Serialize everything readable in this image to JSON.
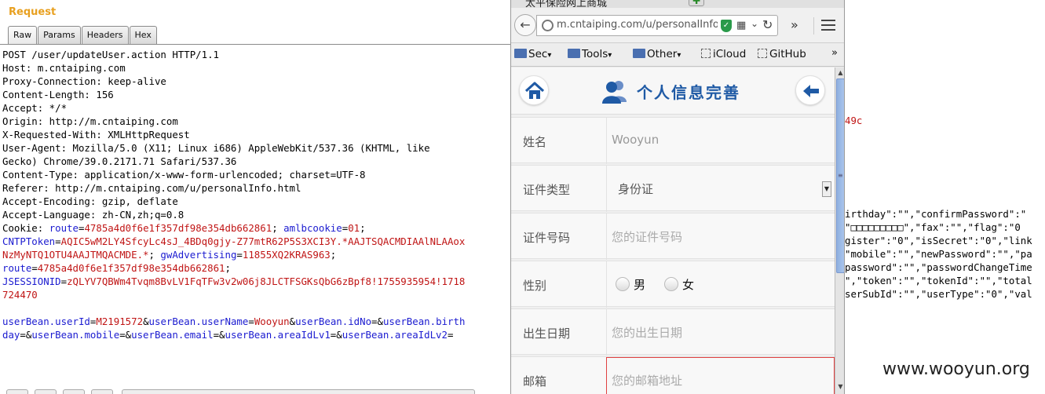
{
  "request": {
    "title": "Request",
    "tabs": [
      "Raw",
      "Params",
      "Headers",
      "Hex"
    ],
    "lines": [
      [
        {
          "t": "POST /user/updateUser.action HTTP/1.1"
        }
      ],
      [
        {
          "t": "Host: m.cntaiping.com"
        }
      ],
      [
        {
          "t": "Proxy-Connection: keep-alive"
        }
      ],
      [
        {
          "t": "Content-Length: 156"
        }
      ],
      [
        {
          "t": "Accept: */*"
        }
      ],
      [
        {
          "t": "Origin: http://m.cntaiping.com"
        }
      ],
      [
        {
          "t": "X-Requested-With: XMLHttpRequest"
        }
      ],
      [
        {
          "t": "User-Agent: Mozilla/5.0 (X11; Linux i686) AppleWebKit/537.36 (KHTML, like"
        }
      ],
      [
        {
          "t": "Gecko) Chrome/39.0.2171.71 Safari/537.36"
        }
      ],
      [
        {
          "t": "Content-Type: application/x-www-form-urlencoded; charset=UTF-8"
        }
      ],
      [
        {
          "t": "Referer: http://m.cntaiping.com/u/personalInfo.html"
        }
      ],
      [
        {
          "t": "Accept-Encoding: gzip, deflate"
        }
      ],
      [
        {
          "t": "Accept-Language: zh-CN,zh;q=0.8"
        }
      ],
      [
        {
          "t": "Cookie: "
        },
        {
          "t": "route",
          "c": "k"
        },
        {
          "t": "="
        },
        {
          "t": "4785a4d0f6e1f357df98e354db662861",
          "c": "v"
        },
        {
          "t": "; "
        },
        {
          "t": "amlbcookie",
          "c": "k"
        },
        {
          "t": "="
        },
        {
          "t": "01",
          "c": "v"
        },
        {
          "t": ";"
        }
      ],
      [
        {
          "t": "CNTPToken",
          "c": "k"
        },
        {
          "t": "="
        },
        {
          "t": "AQIC5wM2LY4SfcyLc4sJ_4BDq0gjy-Z77mtR62P5S3XCI3Y.*AAJTSQACMDIAAlNLAAox",
          "c": "v"
        }
      ],
      [
        {
          "t": "NzMyNTQ1OTU4AAJTMQACMDE.*",
          "c": "v"
        },
        {
          "t": "; "
        },
        {
          "t": "gwAdvertising",
          "c": "k"
        },
        {
          "t": "="
        },
        {
          "t": "11855XQ2KRAS963",
          "c": "v"
        },
        {
          "t": ";"
        }
      ],
      [
        {
          "t": "route",
          "c": "k"
        },
        {
          "t": "="
        },
        {
          "t": "4785a4d0f6e1f357df98e354db662861",
          "c": "v"
        },
        {
          "t": ";"
        }
      ],
      [
        {
          "t": "JSESSIONID",
          "c": "k"
        },
        {
          "t": "="
        },
        {
          "t": "zQLYV7QBWm4Tvqm8BvLV1FqTFw3v2w06j8JLCTFSGKsQbG6zBpf8!1755935954!1718",
          "c": "v"
        }
      ],
      [
        {
          "t": "724470",
          "c": "v"
        }
      ],
      [
        {
          "t": ""
        }
      ],
      [
        {
          "t": "userBean.userId",
          "c": "k"
        },
        {
          "t": "="
        },
        {
          "t": "M2191572",
          "c": "v"
        },
        {
          "t": "&"
        },
        {
          "t": "userBean.userName",
          "c": "k"
        },
        {
          "t": "="
        },
        {
          "t": "Wooyun",
          "c": "v"
        },
        {
          "t": "&"
        },
        {
          "t": "userBean.idNo",
          "c": "k"
        },
        {
          "t": "=&"
        },
        {
          "t": "userBean.birth",
          "c": "k"
        }
      ],
      [
        {
          "t": "day",
          "c": "k"
        },
        {
          "t": "=&"
        },
        {
          "t": "userBean.mobile",
          "c": "k"
        },
        {
          "t": "=&"
        },
        {
          "t": "userBean.email",
          "c": "k"
        },
        {
          "t": "=&"
        },
        {
          "t": "userBean.areaIdLv1",
          "c": "k"
        },
        {
          "t": "=&"
        },
        {
          "t": "userBean.areaIdLv2",
          "c": "k"
        },
        {
          "t": "="
        }
      ]
    ]
  },
  "response_fragment": {
    "code": "49c",
    "lines": [
      "irthday\":\"\",\"confirmPassword\":\"",
      "\"□□□□□□□□□\",\"fax\":\"\",\"flag\":\"0",
      "gister\":\"0\",\"isSecret\":\"0\",\"link",
      "\"mobile\":\"\",\"newPassword\":\"\",\"pa",
      "password\":\"\",\"passwordChangeTime",
      "\",\"token\":\"\",\"tokenId\":\"\",\"total",
      "serSubId\":\"\",\"userType\":\"0\",\"val"
    ],
    "watermark": "www.wooyun.org"
  },
  "browser": {
    "tab_title": "太平保险网上商城",
    "url": "m.cntaiping.com/u/personalInfo",
    "bookmarks": [
      "Sec",
      "Tools",
      "Other",
      "iCloud",
      "GitHub"
    ]
  },
  "page": {
    "title": "个人信息完善",
    "fields": [
      {
        "label": "姓名",
        "value": "Wooyun"
      },
      {
        "label": "证件类型",
        "value": "身份证"
      },
      {
        "label": "证件号码",
        "placeholder": "您的证件号码"
      },
      {
        "label": "性别",
        "options": [
          "男",
          "女"
        ]
      },
      {
        "label": "出生日期",
        "placeholder": "您的出生日期"
      },
      {
        "label": "邮箱",
        "placeholder": "您的邮箱地址"
      }
    ]
  }
}
